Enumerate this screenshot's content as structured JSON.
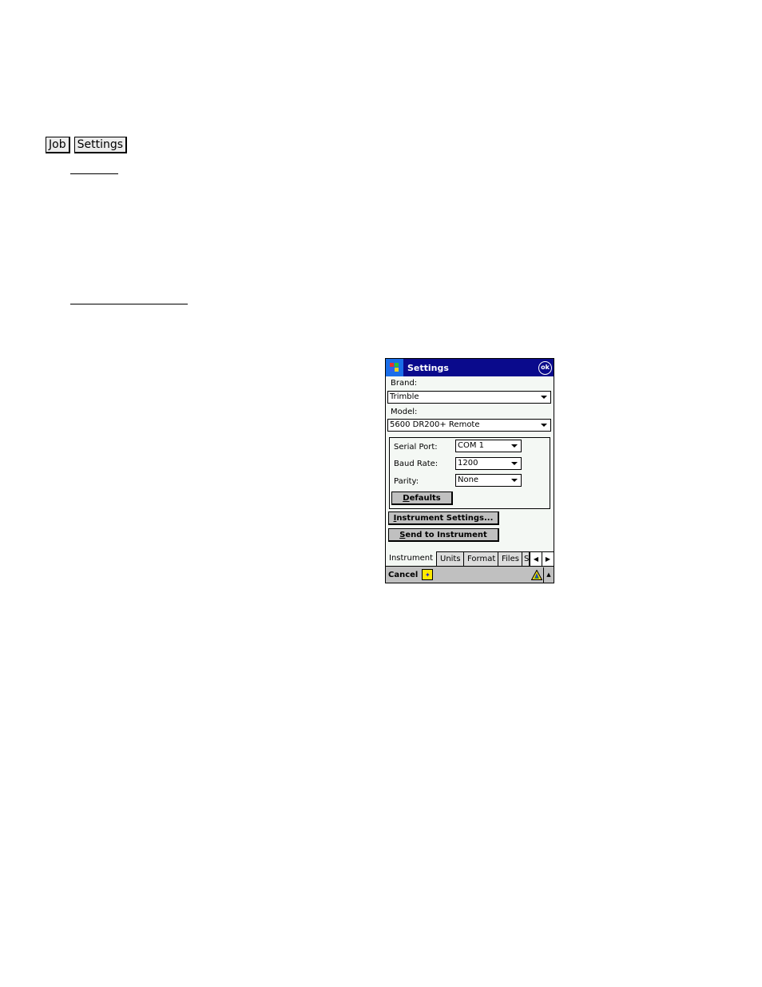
{
  "breadcrumb": {
    "items": [
      {
        "label": "Job"
      },
      {
        "label": "Settings"
      }
    ]
  },
  "device": {
    "title": "Settings",
    "ok_label": "ok",
    "brand": {
      "label": "Brand:",
      "value": "Trimble"
    },
    "model": {
      "label": "Model:",
      "value": "5600 DR200+ Remote"
    },
    "serial_port": {
      "label": "Serial Port:",
      "value": "COM 1"
    },
    "baud_rate": {
      "label": "Baud Rate:",
      "value": "1200"
    },
    "parity": {
      "label": "Parity:",
      "value": "None"
    },
    "defaults_button": {
      "accel": "D",
      "rest": "efaults"
    },
    "instrument_settings_button": {
      "accel": "I",
      "rest": "nstrument Settings..."
    },
    "send_button": {
      "accel": "S",
      "rest": "end to Instrument"
    },
    "tabs": [
      {
        "label": "Instrument",
        "active": true
      },
      {
        "label": "Units"
      },
      {
        "label": "Format"
      },
      {
        "label": "Files"
      },
      {
        "label": "S"
      }
    ],
    "cancel_label": "Cancel",
    "icons": {
      "start": "windows-start-icon",
      "ok": "ok-icon",
      "sip": "keyboard-sip-icon",
      "warning": "warning-icon",
      "sip_up": "sip-up-arrow-icon",
      "tab_left": "chevron-left-icon",
      "tab_right": "chevron-right-icon"
    },
    "colors": {
      "titlebar": "#0a0a8c",
      "start_button": "#1a6ee8",
      "background": "#f4f8f4",
      "button": "#c0c0c0",
      "sip": "#ffe900"
    }
  }
}
